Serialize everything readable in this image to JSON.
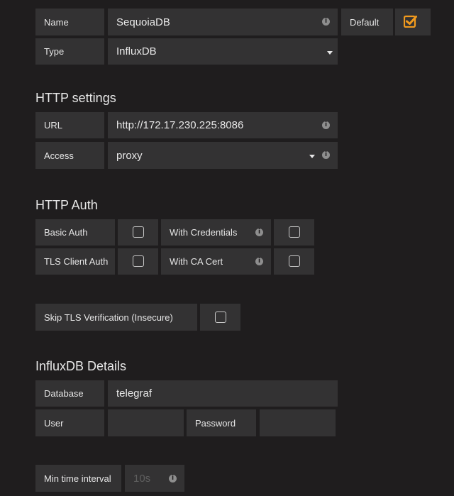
{
  "basic": {
    "name_label": "Name",
    "name_value": "SequoiaDB",
    "default_label": "Default",
    "default_checked": true,
    "type_label": "Type",
    "type_value": "InfluxDB"
  },
  "http_settings": {
    "heading": "HTTP settings",
    "url_label": "URL",
    "url_value": "http://172.17.230.225:8086",
    "access_label": "Access",
    "access_value": "proxy"
  },
  "http_auth": {
    "heading": "HTTP Auth",
    "basic_auth_label": "Basic Auth",
    "with_credentials_label": "With Credentials",
    "tls_client_auth_label": "TLS Client Auth",
    "with_ca_cert_label": "With CA Cert",
    "skip_tls_label": "Skip TLS Verification (Insecure)"
  },
  "influx": {
    "heading": "InfluxDB Details",
    "database_label": "Database",
    "database_value": "telegraf",
    "user_label": "User",
    "user_value": "",
    "password_label": "Password",
    "password_value": "",
    "min_interval_label": "Min time interval",
    "min_interval_placeholder": "10s"
  },
  "icons": {
    "info": "i",
    "checkmark_color": "#f19a1e"
  }
}
